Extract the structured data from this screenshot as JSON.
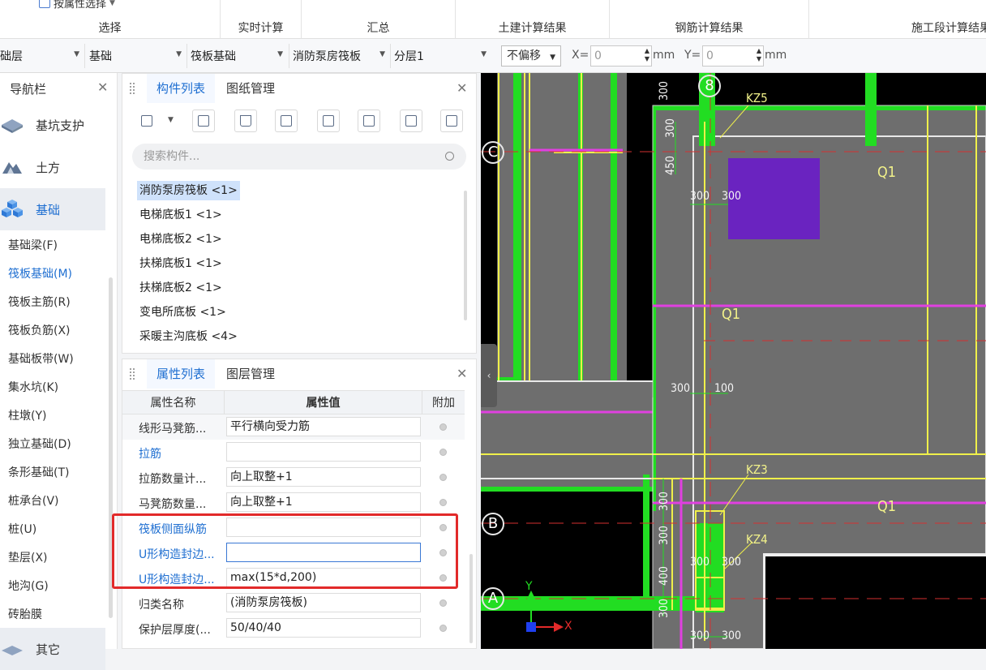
{
  "ribbon": {
    "attr_select": "按属性选择",
    "groups": [
      "选择",
      "实时计算",
      "汇总",
      "土建计算结果",
      "钢筋计算结果",
      "施工段计算结果"
    ]
  },
  "toolbar": {
    "floor": "础层",
    "category": "基础",
    "type": "筏板基础",
    "component": "消防泵房筏板",
    "layer": "分层1",
    "offset": "不偏移",
    "x_label": "X=",
    "x_value": "0",
    "y_label": "Y=",
    "y_value": "0",
    "unit": "mm"
  },
  "nav": {
    "title": "导航栏",
    "categories": [
      {
        "label": "基坑支护",
        "icon": "pit-support-icon"
      },
      {
        "label": "土方",
        "icon": "earthwork-icon"
      },
      {
        "label": "基础",
        "icon": "foundation-icon"
      }
    ],
    "items": [
      "基础梁(F)",
      "筏板基础(M)",
      "筏板主筋(R)",
      "筏板负筋(X)",
      "基础板带(W)",
      "集水坑(K)",
      "柱墩(Y)",
      "独立基础(D)",
      "条形基础(T)",
      "桩承台(V)",
      "桩(U)",
      "垫层(X)",
      "地沟(G)",
      "砖胎膜"
    ],
    "bottom_category": "其它"
  },
  "component_panel": {
    "tabs": [
      "构件列表",
      "图纸管理"
    ],
    "search_placeholder": "搜索构件...",
    "items": [
      "消防泵房筏板 <1>",
      "电梯底板1 <1>",
      "电梯底板2 <1>",
      "扶梯底板1 <1>",
      "扶梯底板2 <1>",
      "变电所底板 <1>",
      "采暖主沟底板 <4>"
    ]
  },
  "property_panel": {
    "tabs": [
      "属性列表",
      "图层管理"
    ],
    "headers": [
      "属性名称",
      "属性值",
      "附加"
    ],
    "rows": [
      {
        "name": "线形马凳筋...",
        "value": "平行横向受力筋",
        "blue": false
      },
      {
        "name": "拉筋",
        "value": "",
        "blue": true
      },
      {
        "name": "拉筋数量计...",
        "value": "向上取整+1",
        "blue": false
      },
      {
        "name": "马凳筋数量...",
        "value": "向上取整+1",
        "blue": false
      },
      {
        "name": "筏板侧面纵筋",
        "value": "",
        "blue": true
      },
      {
        "name": "U形构造封边...",
        "value": "",
        "blue": true
      },
      {
        "name": "U形构造封边...",
        "value": "max(15*d,200)",
        "blue": true
      },
      {
        "name": "归类名称",
        "value": "(消防泵房筏板)",
        "blue": false
      },
      {
        "name": "保护层厚度(...",
        "value": "50/40/40",
        "blue": false
      }
    ]
  },
  "canvas": {
    "axis_labels": [
      "8",
      "C",
      "B",
      "A"
    ],
    "column_labels": [
      "KZ5",
      "KZ3",
      "KZ4"
    ],
    "slab_labels": [
      "Q1",
      "Q1",
      "Q1"
    ],
    "dims": [
      "300",
      "450",
      "300",
      "300",
      "300",
      "100",
      "300",
      "300",
      "300",
      "300",
      "400",
      "300",
      "300",
      "300",
      "300"
    ],
    "ucs": {
      "x": "X",
      "y": "Y"
    },
    "colors": {
      "green": "#22dd22",
      "yellow": "#f0f04a",
      "magenta": "#e040e0",
      "purple": "#6a23c0",
      "gray": "#6e6e6e"
    }
  }
}
